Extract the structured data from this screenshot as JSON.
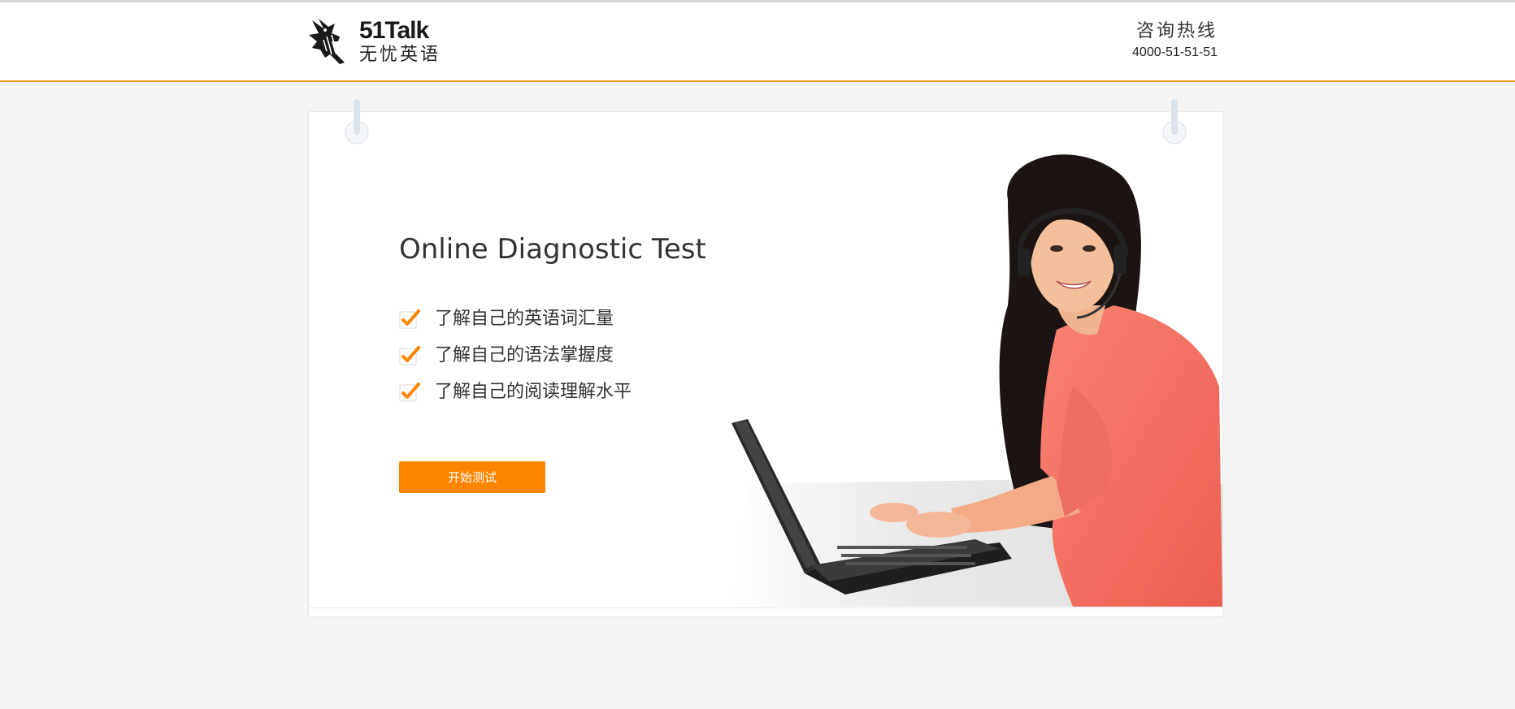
{
  "header": {
    "logo": {
      "brand": "51Talk",
      "subtitle": "无忧英语",
      "icon": "rabbit-hand-logo-icon"
    },
    "hotline": {
      "label": "咨询热线",
      "number": "4000-51-51-51"
    }
  },
  "main": {
    "title": "Online Diagnostic Test",
    "features": [
      {
        "icon": "checkmark-icon",
        "text": "了解自己的英语词汇量"
      },
      {
        "icon": "checkmark-icon",
        "text": "了解自己的语法掌握度"
      },
      {
        "icon": "checkmark-icon",
        "text": "了解自己的阅读理解水平"
      }
    ],
    "start_button": "开始测试",
    "hero_image": "woman-with-headset-at-laptop"
  },
  "colors": {
    "accent": "#ff8400",
    "header_border": "#f39a1e",
    "background": "#f5f5f5"
  }
}
